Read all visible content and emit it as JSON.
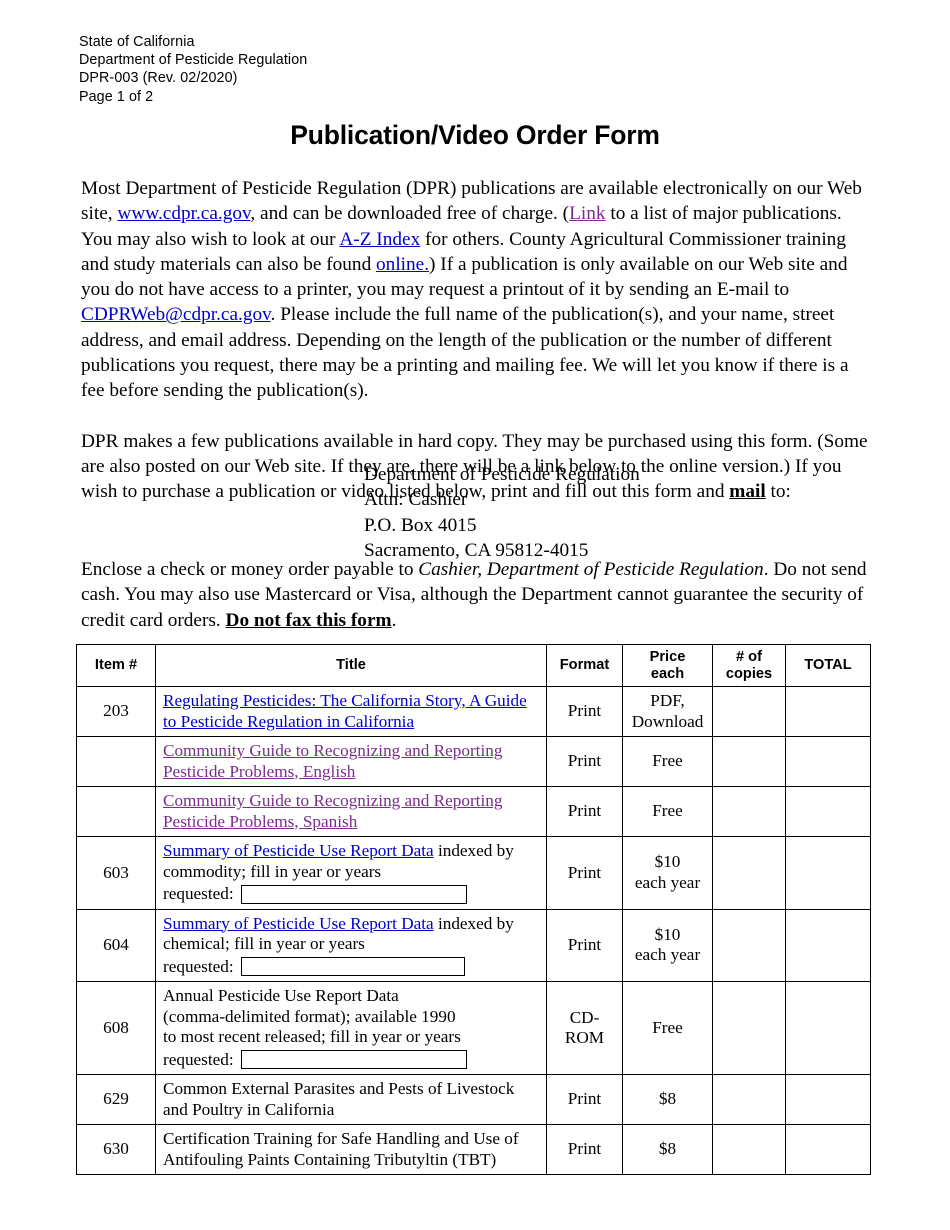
{
  "header": {
    "lines": [
      "State of California",
      "Department of Pesticide Regulation",
      "DPR-003 (Rev. 02/2020)",
      "Page 1 of 2"
    ],
    "line1": "State of California",
    "line2": "Department of Pesticide Regulation",
    "line3": "DPR-003 (Rev. 02/2020)",
    "line4": "Page 1 of 2"
  },
  "title": "Publication/Video Order Form",
  "paragraph1": {
    "t1": "Most Department of Pesticide Regulation (DPR) publications are available electronically on our Web site, ",
    "link_cdpr": "www.cdpr.ca.gov",
    "t2": ", and can be downloaded free of charge. (",
    "link_link": "Link",
    "t3": " to a list of major publications. You may also wish to look at our ",
    "link_az": "A-Z Index",
    "t4": " for others. County Agricultural Commissioner training and study materials can also be found ",
    "link_online": "online.",
    "t5": ") If a publication is only available on our Web site and you do not have access to a printer, you may request a printout of it by sending an E-mail to ",
    "link_email": "CDPRWeb@cdpr.ca.gov",
    "t6": ". Please include the full name of the publication(s), and your name, street address, and email address. Depending on the length of the publication or the number of different publications you request, there may be a printing and mailing fee. We will let you know if there is a fee before sending the publication(s)."
  },
  "paragraph2": {
    "t1": "DPR makes a few publications available in hard copy. They may be purchased using this form. (Some are also posted on our Web site. If they are, there will be a link below to the online version.) If you wish to purchase a publication or video listed below, print and fill out this form and ",
    "emph_mail": "mail",
    "t2": " to:"
  },
  "address": {
    "line1": "Department of Pesticide Regulation",
    "line2": "Attn: Cashier",
    "line3": "P.O. Box 4015",
    "line4": "Sacramento, CA 95812-4015"
  },
  "paragraph3": {
    "t1": "Enclose a check or money order payable to ",
    "italic_payee": "Cashier, Department of Pesticide Regulation",
    "t2": ". Do not send cash. You may also use Mastercard or Visa, although the Department cannot guarantee the security of credit card orders. ",
    "emph_nofax": "Do not fax this form",
    "t3": "."
  },
  "table": {
    "headers": {
      "item": "Item #",
      "title": "Title",
      "format": "Format",
      "price": "Price each",
      "price_l1": "Price",
      "price_l2": "each",
      "copies": "# of copies",
      "copies_l1": "# of",
      "copies_l2": "copies",
      "total": "TOTAL"
    },
    "rows": [
      {
        "item": "203",
        "title": "Regulating Pesticides: The California Story, A Guide to Pesticide Regulation in California",
        "title_link": true,
        "title_visited": false,
        "format": "Print",
        "price_l1": "PDF,",
        "price_l2": "Download",
        "copies": "",
        "total": ""
      },
      {
        "item": "",
        "title": "Community Guide to Recognizing and Reporting Pesticide Problems, English",
        "title_link": true,
        "title_visited": true,
        "format": "Print",
        "price_l1": "Free",
        "price_l2": "",
        "copies": "",
        "total": ""
      },
      {
        "item": "",
        "title": "Community Guide to Recognizing and Reporting Pesticide Problems, Spanish",
        "title_link": true,
        "title_visited": true,
        "format": "Print",
        "price_l1": "Free",
        "price_l2": "",
        "copies": "",
        "total": ""
      },
      {
        "item": "603",
        "title_link_text": "Summary of Pesticide Use Report Data",
        "title_rest": " indexed by commodity; fill in year or years",
        "requested_label": "requested:",
        "field_value": "",
        "format": "Print",
        "price_l1": "$10",
        "price_l2": "each year",
        "copies": "",
        "total": ""
      },
      {
        "item": "604",
        "title_link_text": "Summary of Pesticide Use Report Data",
        "title_rest": " indexed by chemical; fill in year or years",
        "requested_label": "requested:",
        "field_value": "",
        "format": "Print",
        "price_l1": "$10",
        "price_l2": "each year",
        "copies": "",
        "total": ""
      },
      {
        "item": "608",
        "title_plain_l1": "Annual Pesticide Use Report Data",
        "title_plain_l2": "(comma-delimited format); available 1990",
        "title_plain_l3": "to most recent released; fill in year or years",
        "requested_label": "requested:",
        "field_value": "",
        "format_l1": "CD-",
        "format_l2": "ROM",
        "price_l1": "Free",
        "price_l2": "",
        "copies": "",
        "total": ""
      },
      {
        "item": "629",
        "title": "Common External Parasites and Pests of Livestock and Poultry in California",
        "title_link": false,
        "format": "Print",
        "price_l1": "$8",
        "price_l2": "",
        "copies": "",
        "total": ""
      },
      {
        "item": "630",
        "title": "Certification Training for Safe Handling and Use of Antifouling Paints Containing Tributyltin (TBT)",
        "title_link": false,
        "format": "Print",
        "price_l1": "$8",
        "price_l2": "",
        "copies": "",
        "total": ""
      }
    ]
  },
  "colors": {
    "link": "#0000cc",
    "visited_link": "#7b2d8e",
    "text": "#000000",
    "border": "#000000"
  }
}
